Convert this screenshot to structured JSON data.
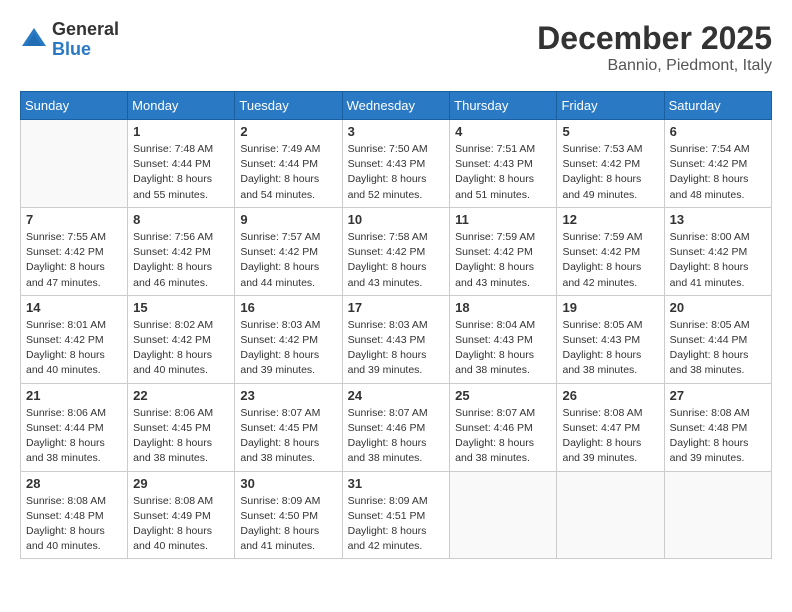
{
  "header": {
    "logo_general": "General",
    "logo_blue": "Blue",
    "month_title": "December 2025",
    "location": "Bannio, Piedmont, Italy"
  },
  "days_of_week": [
    "Sunday",
    "Monday",
    "Tuesday",
    "Wednesday",
    "Thursday",
    "Friday",
    "Saturday"
  ],
  "weeks": [
    [
      {
        "day": "",
        "info": ""
      },
      {
        "day": "1",
        "info": "Sunrise: 7:48 AM\nSunset: 4:44 PM\nDaylight: 8 hours\nand 55 minutes."
      },
      {
        "day": "2",
        "info": "Sunrise: 7:49 AM\nSunset: 4:44 PM\nDaylight: 8 hours\nand 54 minutes."
      },
      {
        "day": "3",
        "info": "Sunrise: 7:50 AM\nSunset: 4:43 PM\nDaylight: 8 hours\nand 52 minutes."
      },
      {
        "day": "4",
        "info": "Sunrise: 7:51 AM\nSunset: 4:43 PM\nDaylight: 8 hours\nand 51 minutes."
      },
      {
        "day": "5",
        "info": "Sunrise: 7:53 AM\nSunset: 4:42 PM\nDaylight: 8 hours\nand 49 minutes."
      },
      {
        "day": "6",
        "info": "Sunrise: 7:54 AM\nSunset: 4:42 PM\nDaylight: 8 hours\nand 48 minutes."
      }
    ],
    [
      {
        "day": "7",
        "info": "Sunrise: 7:55 AM\nSunset: 4:42 PM\nDaylight: 8 hours\nand 47 minutes."
      },
      {
        "day": "8",
        "info": "Sunrise: 7:56 AM\nSunset: 4:42 PM\nDaylight: 8 hours\nand 46 minutes."
      },
      {
        "day": "9",
        "info": "Sunrise: 7:57 AM\nSunset: 4:42 PM\nDaylight: 8 hours\nand 44 minutes."
      },
      {
        "day": "10",
        "info": "Sunrise: 7:58 AM\nSunset: 4:42 PM\nDaylight: 8 hours\nand 43 minutes."
      },
      {
        "day": "11",
        "info": "Sunrise: 7:59 AM\nSunset: 4:42 PM\nDaylight: 8 hours\nand 43 minutes."
      },
      {
        "day": "12",
        "info": "Sunrise: 7:59 AM\nSunset: 4:42 PM\nDaylight: 8 hours\nand 42 minutes."
      },
      {
        "day": "13",
        "info": "Sunrise: 8:00 AM\nSunset: 4:42 PM\nDaylight: 8 hours\nand 41 minutes."
      }
    ],
    [
      {
        "day": "14",
        "info": "Sunrise: 8:01 AM\nSunset: 4:42 PM\nDaylight: 8 hours\nand 40 minutes."
      },
      {
        "day": "15",
        "info": "Sunrise: 8:02 AM\nSunset: 4:42 PM\nDaylight: 8 hours\nand 40 minutes."
      },
      {
        "day": "16",
        "info": "Sunrise: 8:03 AM\nSunset: 4:42 PM\nDaylight: 8 hours\nand 39 minutes."
      },
      {
        "day": "17",
        "info": "Sunrise: 8:03 AM\nSunset: 4:43 PM\nDaylight: 8 hours\nand 39 minutes."
      },
      {
        "day": "18",
        "info": "Sunrise: 8:04 AM\nSunset: 4:43 PM\nDaylight: 8 hours\nand 38 minutes."
      },
      {
        "day": "19",
        "info": "Sunrise: 8:05 AM\nSunset: 4:43 PM\nDaylight: 8 hours\nand 38 minutes."
      },
      {
        "day": "20",
        "info": "Sunrise: 8:05 AM\nSunset: 4:44 PM\nDaylight: 8 hours\nand 38 minutes."
      }
    ],
    [
      {
        "day": "21",
        "info": "Sunrise: 8:06 AM\nSunset: 4:44 PM\nDaylight: 8 hours\nand 38 minutes."
      },
      {
        "day": "22",
        "info": "Sunrise: 8:06 AM\nSunset: 4:45 PM\nDaylight: 8 hours\nand 38 minutes."
      },
      {
        "day": "23",
        "info": "Sunrise: 8:07 AM\nSunset: 4:45 PM\nDaylight: 8 hours\nand 38 minutes."
      },
      {
        "day": "24",
        "info": "Sunrise: 8:07 AM\nSunset: 4:46 PM\nDaylight: 8 hours\nand 38 minutes."
      },
      {
        "day": "25",
        "info": "Sunrise: 8:07 AM\nSunset: 4:46 PM\nDaylight: 8 hours\nand 38 minutes."
      },
      {
        "day": "26",
        "info": "Sunrise: 8:08 AM\nSunset: 4:47 PM\nDaylight: 8 hours\nand 39 minutes."
      },
      {
        "day": "27",
        "info": "Sunrise: 8:08 AM\nSunset: 4:48 PM\nDaylight: 8 hours\nand 39 minutes."
      }
    ],
    [
      {
        "day": "28",
        "info": "Sunrise: 8:08 AM\nSunset: 4:48 PM\nDaylight: 8 hours\nand 40 minutes."
      },
      {
        "day": "29",
        "info": "Sunrise: 8:08 AM\nSunset: 4:49 PM\nDaylight: 8 hours\nand 40 minutes."
      },
      {
        "day": "30",
        "info": "Sunrise: 8:09 AM\nSunset: 4:50 PM\nDaylight: 8 hours\nand 41 minutes."
      },
      {
        "day": "31",
        "info": "Sunrise: 8:09 AM\nSunset: 4:51 PM\nDaylight: 8 hours\nand 42 minutes."
      },
      {
        "day": "",
        "info": ""
      },
      {
        "day": "",
        "info": ""
      },
      {
        "day": "",
        "info": ""
      }
    ]
  ]
}
